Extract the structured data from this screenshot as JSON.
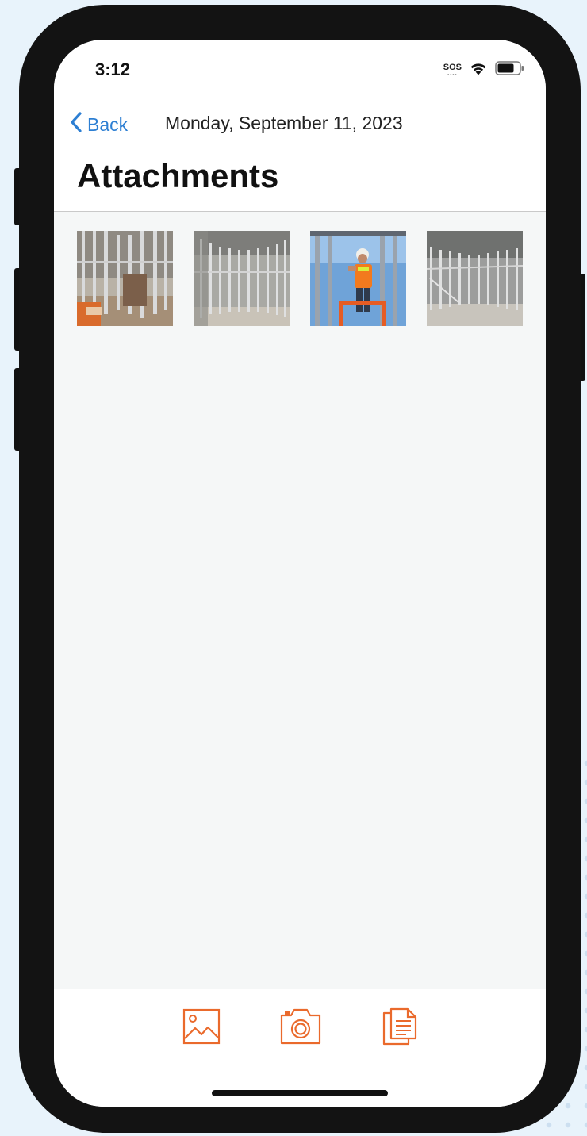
{
  "status_bar": {
    "time": "3:12",
    "sos_label": "SOS",
    "icons": [
      "sos-icon",
      "wifi-icon",
      "battery-icon"
    ]
  },
  "nav": {
    "back_label": "Back",
    "date": "Monday, September 11, 2023",
    "title": "Attachments"
  },
  "attachments": [
    {
      "name": "attachment-photo-1",
      "subject": "interior metal stud framing"
    },
    {
      "name": "attachment-photo-2",
      "subject": "metal stud wall framing corridor"
    },
    {
      "name": "attachment-photo-3",
      "subject": "worker in hard hat on lift"
    },
    {
      "name": "attachment-photo-4",
      "subject": "open floor metal framing"
    }
  ],
  "toolbar": {
    "buttons": [
      "photo-library-icon",
      "camera-icon",
      "document-icon"
    ],
    "accent_color": "#ea6a2c"
  },
  "colors": {
    "link_blue": "#2d7fd3",
    "screen_background": "#f5f7f7"
  }
}
